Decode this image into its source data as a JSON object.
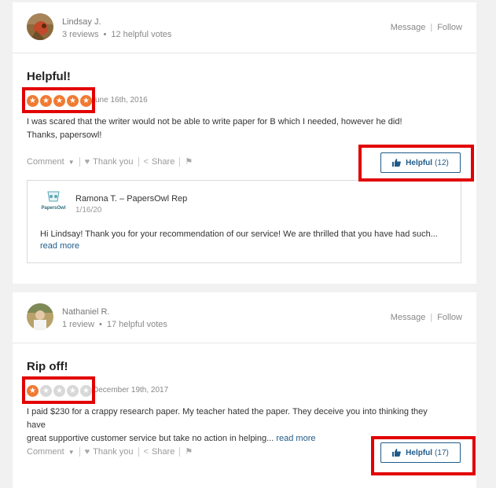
{
  "reviews": [
    {
      "reviewer": {
        "name": "Lindsay J.",
        "reviews": "3 reviews",
        "votes": "12 helpful votes"
      },
      "header_actions": {
        "message": "Message",
        "separator": "|",
        "follow": "Follow"
      },
      "title": "Helpful!",
      "rating": 5,
      "rating_max": 5,
      "date": "June 16th, 2016",
      "body_line1": "I was scared that the writer would not be able to write paper for B which I needed, however he did!",
      "body_line2": "Thanks, papersowl!",
      "actions": {
        "comment": "Comment",
        "thank_you": "Thank you",
        "share": "Share"
      },
      "helpful": {
        "label": "Helpful",
        "count": "(12)"
      },
      "reply": {
        "logo_text": "PapersOwl",
        "name": "Ramona T. – PapersOwl Rep",
        "date": "1/16/20",
        "text": "Hi Lindsay! Thank you for your recommendation of our service! We are thrilled that you have had such...",
        "read_more": "read more"
      }
    },
    {
      "reviewer": {
        "name": "Nathaniel R.",
        "reviews": "1 review",
        "votes": "17 helpful votes"
      },
      "header_actions": {
        "message": "Message",
        "separator": "|",
        "follow": "Follow"
      },
      "title": "Rip off!",
      "rating": 1,
      "rating_max": 5,
      "date": "December 19th, 2017",
      "body_line1": "I paid $230 for a crappy research paper. My teacher hated the paper. They deceive you into thinking they have",
      "body_line2": "great supportive customer service but take no action in helping...",
      "read_more": "read more",
      "actions": {
        "comment": "Comment",
        "thank_you": "Thank you",
        "share": "Share"
      },
      "helpful": {
        "label": "Helpful",
        "count": "(17)"
      }
    }
  ],
  "colors": {
    "accent": "#1f5b8a",
    "star": "#f07a32",
    "highlight": "#e20000"
  }
}
